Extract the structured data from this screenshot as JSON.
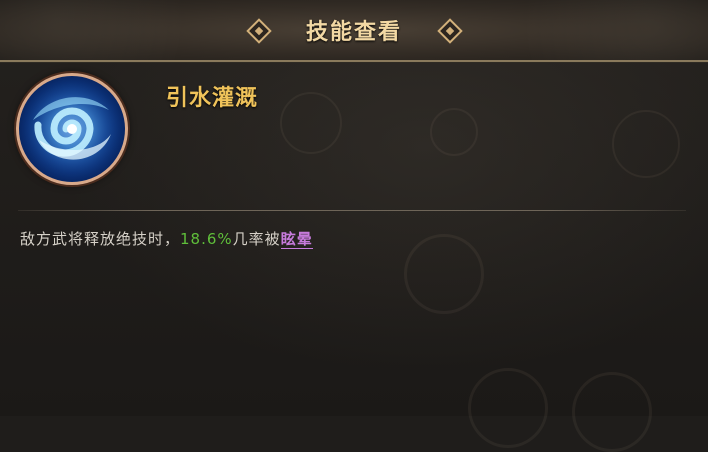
{
  "header": {
    "title": "技能查看"
  },
  "skill": {
    "icon": "water-swirl-icon",
    "name": "引水灌溉",
    "description": {
      "prefix": "敌方武将释放绝技时，",
      "chance": "18.6%",
      "middle": "几率被",
      "effect": "眩晕"
    }
  },
  "colors": {
    "title": "#f3d9a4",
    "skill_name": "#f0c35a",
    "chance": "#5fbf3a",
    "effect": "#c77bdc",
    "text": "#d6d1c8"
  }
}
